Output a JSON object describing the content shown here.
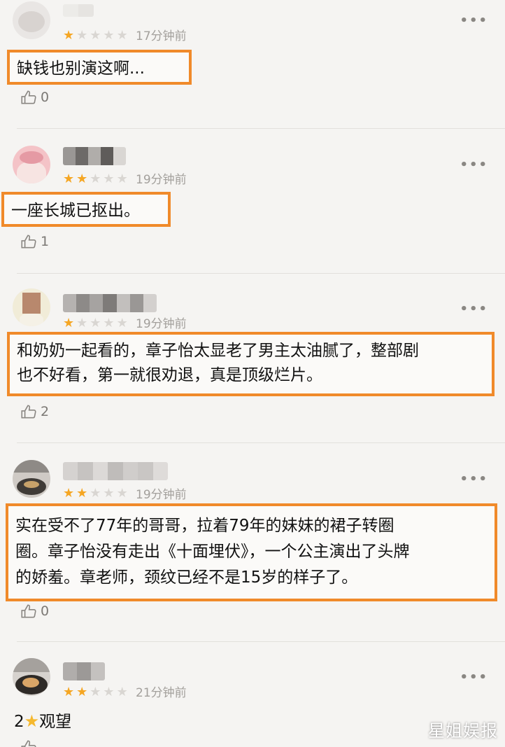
{
  "comments": [
    {
      "rating": 1,
      "time": "17分钟前",
      "text": "缺钱也别演这啊...",
      "likes": "0"
    },
    {
      "rating": 2,
      "time": "19分钟前",
      "text": "一座长城已抠出。",
      "likes": "1"
    },
    {
      "rating": 1,
      "time": "19分钟前",
      "text_line1": "和奶奶一起看的，章子怡太显老了男主太油腻了，整部剧",
      "text_line2": "也不好看，第一就很劝退，真是顶级烂片。",
      "likes": "2"
    },
    {
      "rating": 2,
      "time": "19分钟前",
      "text_line1": "实在受不了77年的哥哥，拉着79年的妹妹的裙子转圈",
      "text_line2": "圈。章子怡没有走出《十面埋伏》，一个公主演出了头牌",
      "text_line3": "的娇羞。章老师，颈纹已经不是15岁的样子了。",
      "likes": "0"
    },
    {
      "rating": 2,
      "time": "21分钟前",
      "text_prefix": "2",
      "text_suffix": "观望"
    }
  ],
  "more_label": "•••",
  "star_glyph": "★",
  "watermark": "星姐娱报",
  "colors": {
    "highlight_border": "#f08a2a",
    "star_on": "#f5a623",
    "star_off": "#d9d6d2"
  }
}
